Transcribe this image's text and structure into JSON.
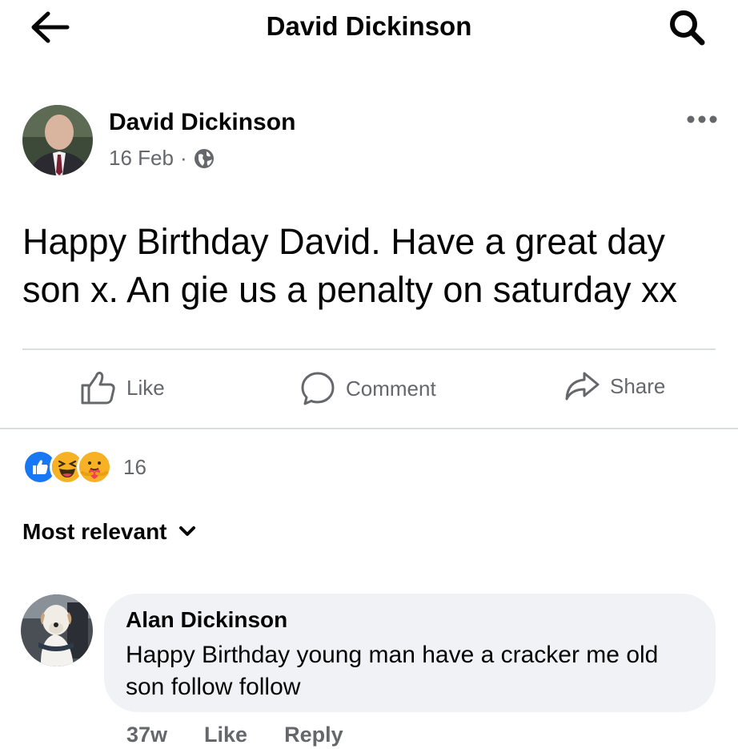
{
  "header": {
    "title": "David Dickinson",
    "back_icon": "arrow-left-icon",
    "search_icon": "search-icon"
  },
  "post": {
    "author": "David Dickinson",
    "date": "16 Feb",
    "separator": "·",
    "privacy_icon": "globe-icon",
    "more_icon": "more-horizontal-icon",
    "text": "Happy Birthday David. Have a great day son x. An gie us a penalty on saturday xx"
  },
  "actions": {
    "like": "Like",
    "comment": "Comment",
    "share": "Share"
  },
  "reactions": {
    "types": [
      "like",
      "haha",
      "care"
    ],
    "count": "16",
    "colors": {
      "like": "#1877f2",
      "haha": "#f7b125"
    }
  },
  "comments": {
    "sort_label": "Most relevant",
    "items": [
      {
        "author": "Alan Dickinson",
        "text": "Happy Birthday young man have a cracker me old son follow follow",
        "time": "37w",
        "like": "Like",
        "reply": "Reply"
      }
    ]
  }
}
